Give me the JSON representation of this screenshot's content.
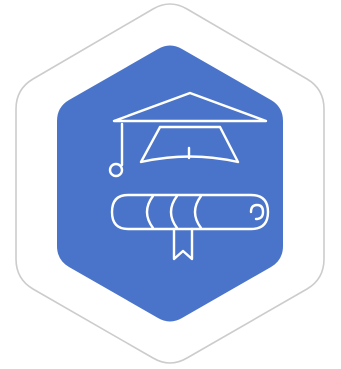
{
  "badge": {
    "icon": "graduation-cap-and-diploma-icon",
    "colors": {
      "background": "#ffffff",
      "outer_outline": "#cccccc",
      "hexagon_fill": "#4a74c9",
      "icon_stroke": "#ffffff"
    }
  }
}
